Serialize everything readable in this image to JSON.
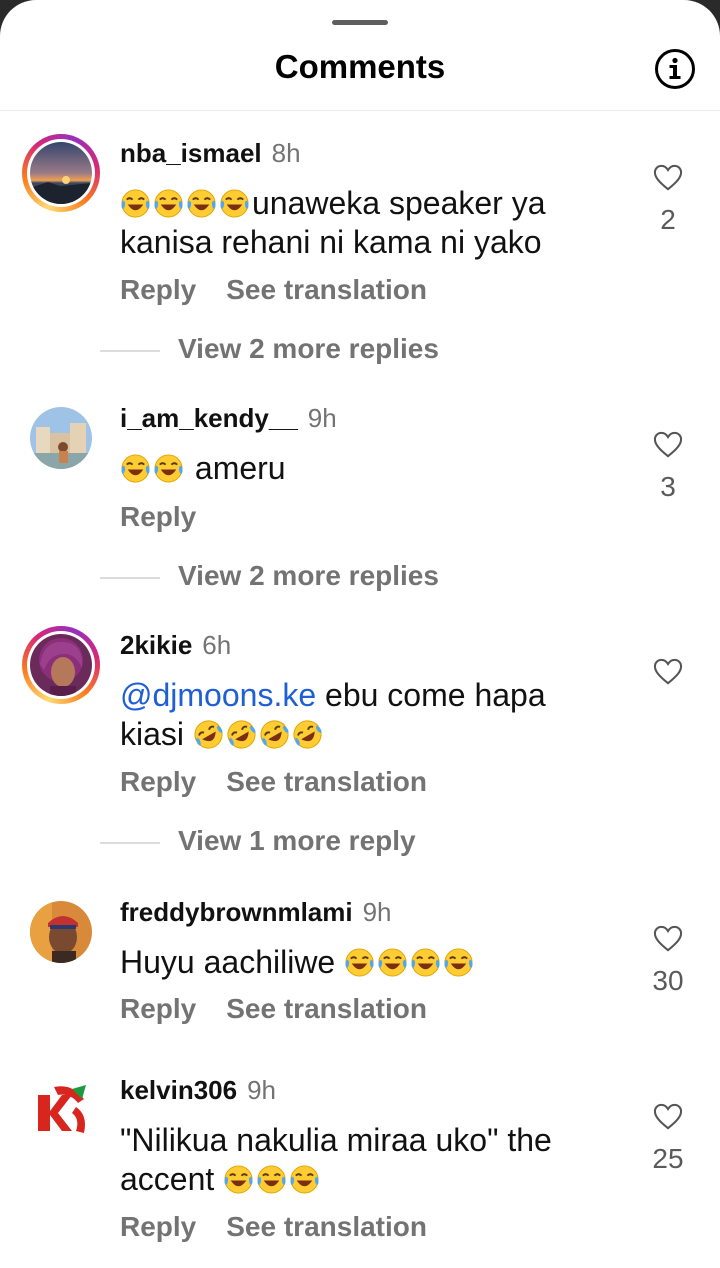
{
  "header": {
    "title": "Comments",
    "info_icon": "info-icon"
  },
  "comments": [
    {
      "username": "nba_ismael",
      "time": "8h",
      "emoji_prefix": [
        "face-with-tears-of-joy",
        "face-with-tears-of-joy",
        "face-with-tears-of-joy",
        "face-with-tears-of-joy"
      ],
      "line1": "unaweka speaker ya",
      "line2": "kanisa rehani ni kama ni yako",
      "reply_label": "Reply",
      "translation_label": "See translation",
      "view_replies": "View 2 more replies",
      "likes": "2",
      "avatar_ring": true
    },
    {
      "username": "i_am_kendy__",
      "time": "9h",
      "emoji_prefix": [
        "face-with-tears-of-joy",
        "face-with-tears-of-joy"
      ],
      "line1": "ameru",
      "reply_label": "Reply",
      "view_replies": "View 2 more replies",
      "likes": "3",
      "avatar_ring": false
    },
    {
      "username": "2kikie",
      "time": "6h",
      "mention": "@djmoons.ke",
      "line1": "ebu come hapa",
      "line2": "kiasi",
      "emoji_suffix": [
        "rolling-on-the-floor-laughing",
        "rolling-on-the-floor-laughing",
        "rolling-on-the-floor-laughing",
        "rolling-on-the-floor-laughing"
      ],
      "reply_label": "Reply",
      "translation_label": "See translation",
      "view_replies": "View 1 more reply",
      "likes": "",
      "avatar_ring": true
    },
    {
      "username": "freddybrownmlami",
      "time": "9h",
      "line1": "Huyu aachiliwe",
      "emoji_suffix": [
        "face-with-tears-of-joy",
        "face-with-tears-of-joy",
        "face-with-tears-of-joy",
        "face-with-tears-of-joy"
      ],
      "reply_label": "Reply",
      "translation_label": "See translation",
      "likes": "30",
      "avatar_ring": false
    },
    {
      "username": "kelvin306",
      "time": "9h",
      "line1": "\"Nilikua nakulia miraa uko\" the",
      "line2": "accent",
      "emoji_suffix": [
        "face-with-tears-of-joy",
        "face-with-tears-of-joy",
        "face-with-tears-of-joy"
      ],
      "reply_label": "Reply",
      "translation_label": "See translation",
      "likes": "25",
      "avatar_ring": false
    }
  ],
  "colors": {
    "mention": "#1f5fd6",
    "secondary_text": "#737373",
    "primary_text": "#111111",
    "background": "#ffffff"
  }
}
